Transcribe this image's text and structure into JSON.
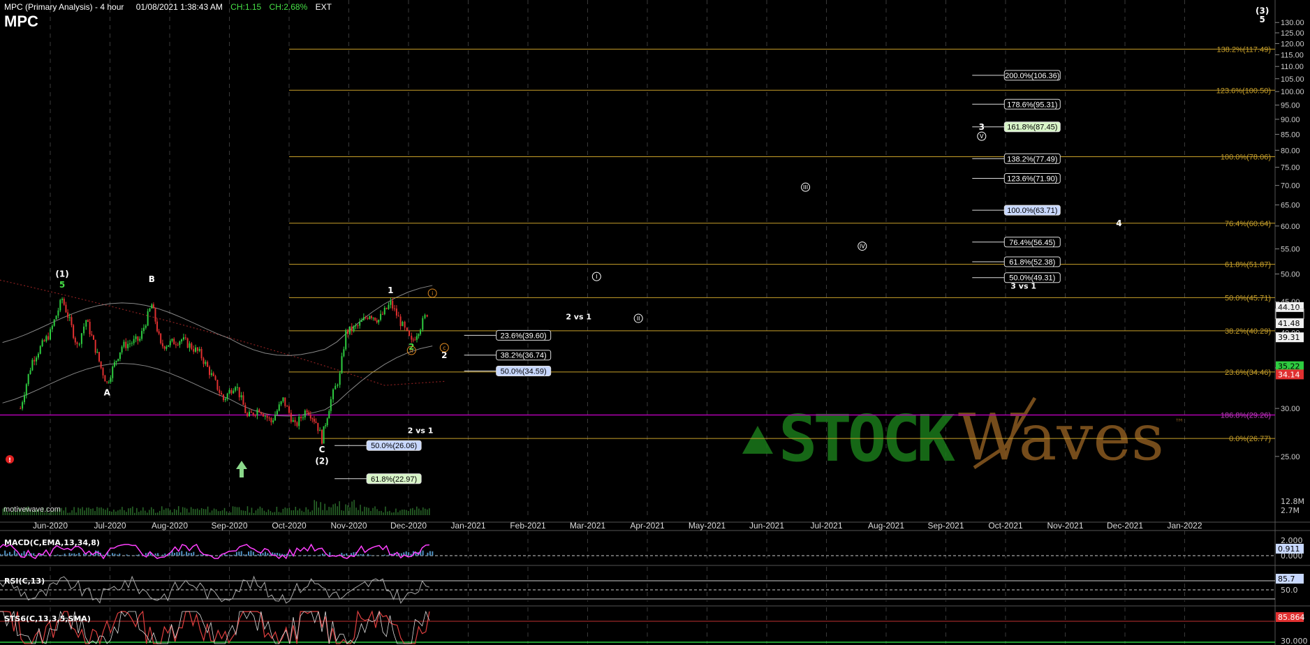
{
  "header": {
    "title": "MPC (Primary Analysis) - 4 hour",
    "datetime": "01/08/2021 1:38:43 AM",
    "change": "CH:1.15",
    "change_pct": "CH:2.68%",
    "session": "EXT",
    "symbol": "MPC"
  },
  "watermark": "motivewave.com",
  "brand": {
    "left": "STOCK",
    "right": "Waves",
    "mark": "™"
  },
  "colors": {
    "background": "#000000",
    "fib_line": "#c8a02a",
    "fib_label": "#c8a02a",
    "grid": "#3a3a3a",
    "candle_up": "#2ecc40",
    "candle_down": "#e03030",
    "ma_red": "#8a2020",
    "band": "#888888",
    "purple_line": "#b000b0",
    "macd_line": "#ff40ff",
    "macd_hist": "#5090c0",
    "stoch_line": "#e04040",
    "brand_green": "#1a7a1a",
    "brand_orange": "#8a5a20"
  },
  "chart_data": {
    "type": "candlestick",
    "price_axis": {
      "min": 20,
      "max": 135,
      "ticks": [
        25.0,
        30.0,
        35.0,
        40.0,
        45.0,
        50.0,
        55.0,
        60.0,
        65.0,
        70.0,
        75.0,
        80.0,
        85.0,
        90.0,
        95.0,
        100.0,
        105.0,
        110.0,
        115.0,
        120.0,
        125.0,
        130.0
      ],
      "scale": "log"
    },
    "time_axis": {
      "labels": [
        "Jun-2020",
        "Jul-2020",
        "Aug-2020",
        "Sep-2020",
        "Oct-2020",
        "Nov-2020",
        "Dec-2020",
        "Jan-2021",
        "Feb-2021",
        "Mar-2021",
        "Apr-2021",
        "May-2021",
        "Jun-2021",
        "Jul-2021",
        "Aug-2021",
        "Sep-2021",
        "Oct-2021",
        "Nov-2021",
        "Dec-2021",
        "Jan-2022"
      ],
      "month_index": [
        0,
        1,
        2,
        3,
        4,
        5,
        6,
        7,
        8,
        9,
        10,
        11,
        12,
        13,
        14,
        15,
        16,
        17,
        18,
        19
      ]
    },
    "price_path": [
      {
        "m": -0.5,
        "p": 30
      },
      {
        "m": -0.3,
        "p": 36
      },
      {
        "m": 0.0,
        "p": 40
      },
      {
        "m": 0.2,
        "p": 45.5
      },
      {
        "m": 0.45,
        "p": 38
      },
      {
        "m": 0.6,
        "p": 42
      },
      {
        "m": 0.85,
        "p": 35
      },
      {
        "m": 0.95,
        "p": 33
      },
      {
        "m": 1.2,
        "p": 38
      },
      {
        "m": 1.5,
        "p": 39
      },
      {
        "m": 1.7,
        "p": 44.5
      },
      {
        "m": 1.85,
        "p": 38
      },
      {
        "m": 2.2,
        "p": 39
      },
      {
        "m": 2.5,
        "p": 37
      },
      {
        "m": 2.7,
        "p": 34
      },
      {
        "m": 2.9,
        "p": 31
      },
      {
        "m": 3.1,
        "p": 33
      },
      {
        "m": 3.3,
        "p": 29
      },
      {
        "m": 3.5,
        "p": 30
      },
      {
        "m": 3.7,
        "p": 28.5
      },
      {
        "m": 3.9,
        "p": 31
      },
      {
        "m": 4.1,
        "p": 28
      },
      {
        "m": 4.3,
        "p": 30
      },
      {
        "m": 4.45,
        "p": 28.5
      },
      {
        "m": 4.55,
        "p": 26.7
      },
      {
        "m": 4.7,
        "p": 31
      },
      {
        "m": 4.85,
        "p": 34
      },
      {
        "m": 4.95,
        "p": 40
      },
      {
        "m": 5.15,
        "p": 41
      },
      {
        "m": 5.35,
        "p": 43
      },
      {
        "m": 5.5,
        "p": 42
      },
      {
        "m": 5.7,
        "p": 44.7
      },
      {
        "m": 5.9,
        "p": 41
      },
      {
        "m": 6.05,
        "p": 38.5
      },
      {
        "m": 6.2,
        "p": 41
      },
      {
        "m": 6.35,
        "p": 43.8
      }
    ],
    "last_price": 43.72,
    "price_tags": [
      {
        "label": "44.10",
        "value": 44.1,
        "style": "white"
      },
      {
        "label": "41.48",
        "value": 41.48,
        "style": "white"
      },
      {
        "label": "39.31",
        "value": 39.31,
        "style": "white"
      },
      {
        "label": "35.22",
        "value": 35.22,
        "style": "green"
      },
      {
        "label": "34.14",
        "value": 34.14,
        "style": "red"
      }
    ],
    "fib_levels_right": [
      {
        "label": "138.2%(117.49)",
        "value": 117.49
      },
      {
        "label": "123.6%(100.50)",
        "value": 100.5
      },
      {
        "label": "100.0%(78.06)",
        "value": 78.06
      },
      {
        "label": "76.4%(60.64)",
        "value": 60.64
      },
      {
        "label": "61.8%(51.87)",
        "value": 51.87
      },
      {
        "label": "50.0%(45.71)",
        "value": 45.71
      },
      {
        "label": "38.2%(40.29)",
        "value": 40.29
      },
      {
        "label": "23.6%(34.46)",
        "value": 34.46
      },
      {
        "label": "186.8%(29.26)",
        "value": 29.26,
        "color": "purple"
      },
      {
        "label": "0.0%(26.77)",
        "value": 26.77
      }
    ],
    "extension_targets": [
      {
        "label": "200.0%(106.36)",
        "value": 106.36,
        "style": "dark"
      },
      {
        "label": "178.6%(95.31)",
        "value": 95.31,
        "style": "dark"
      },
      {
        "label": "161.8%(87.45)",
        "value": 87.45,
        "style": "green"
      },
      {
        "label": "138.2%(77.49)",
        "value": 77.49,
        "style": "dark"
      },
      {
        "label": "123.6%(71.90)",
        "value": 71.9,
        "style": "dark"
      },
      {
        "label": "100.0%(63.71)",
        "value": 63.71,
        "style": "blue"
      },
      {
        "label": "76.4%(56.45)",
        "value": 56.45,
        "style": "dark"
      },
      {
        "label": "61.8%(52.38)",
        "value": 52.38,
        "style": "dark"
      },
      {
        "label": "50.0%(49.31)",
        "value": 49.31,
        "style": "dark"
      }
    ],
    "extension_group_label": "3 vs 1",
    "retrace_targets": [
      {
        "label": "23.6%(39.60)",
        "value": 39.6,
        "style": "dark"
      },
      {
        "label": "38.2%(36.74)",
        "value": 36.74,
        "style": "dark"
      },
      {
        "label": "50.0%(34.59)",
        "value": 34.59,
        "style": "blue"
      }
    ],
    "retrace_group_label": "2 vs 1",
    "lower_targets": [
      {
        "label": "50.0%(26.06)",
        "value": 26.06,
        "style": "blue"
      },
      {
        "label": "61.8%(22.97)",
        "value": 22.97,
        "style": "green"
      }
    ],
    "lower_group_label": "2 vs 1",
    "wave_labels": [
      {
        "text": "(1)",
        "m": 0.2,
        "p": 49.5,
        "color": "#ffffff"
      },
      {
        "text": "5",
        "m": 0.2,
        "p": 47.5,
        "color": "#46e046"
      },
      {
        "text": "B",
        "m": 1.7,
        "p": 48.5,
        "color": "#ffffff"
      },
      {
        "text": "A",
        "m": 0.95,
        "p": 31.5,
        "color": "#ffffff"
      },
      {
        "text": "C",
        "m": 4.55,
        "p": 25.4,
        "color": "#ffffff"
      },
      {
        "text": "(2)",
        "m": 4.55,
        "p": 24.3,
        "color": "#ffffff"
      },
      {
        "text": "1",
        "m": 5.7,
        "p": 46.5,
        "color": "#ffffff"
      },
      {
        "text": "2",
        "m": 6.05,
        "p": 37.5,
        "color": "#46e046"
      },
      {
        "text": "2",
        "m": 6.6,
        "p": 36.3,
        "color": "#ffffff"
      },
      {
        "text": "3",
        "m": 15.6,
        "p": 86.5,
        "color": "#ffffff"
      },
      {
        "text": "4",
        "m": 17.9,
        "p": 60.0,
        "color": "#ffffff"
      },
      {
        "text": "(3)",
        "m": 20.3,
        "p": 134.5,
        "color": "#ffffff"
      },
      {
        "text": "5",
        "m": 20.3,
        "p": 130.0,
        "color": "#ffffff"
      }
    ],
    "circled_labels": [
      {
        "text": "i",
        "m": 6.4,
        "p": 46.0,
        "color": "#e08a20"
      },
      {
        "text": "ii",
        "m": 6.05,
        "p": 37.0,
        "color": "#e08a20"
      },
      {
        "text": "c",
        "m": 6.6,
        "p": 37.4,
        "color": "#e08a20"
      },
      {
        "text": "I",
        "m": 9.15,
        "p": 49.0,
        "color": "#ffffff"
      },
      {
        "text": "II",
        "m": 9.85,
        "p": 41.8,
        "color": "#ffffff"
      },
      {
        "text": "III",
        "m": 12.65,
        "p": 68.8,
        "color": "#ffffff"
      },
      {
        "text": "IV",
        "m": 13.6,
        "p": 55.0,
        "color": "#ffffff"
      },
      {
        "text": "V",
        "m": 15.6,
        "p": 83.5,
        "color": "#ffffff"
      }
    ],
    "indicators": {
      "macd": {
        "label": "MACD(C,EMA,13,34,8)",
        "ticks": [
          "2.000",
          "0.000"
        ],
        "value_tag": "0.911"
      },
      "rsi": {
        "label": "RSI(C,13)",
        "ticks": [
          "50.0"
        ],
        "value_tag": "85.7"
      },
      "stoch": {
        "label": "STS6(C,13,3,5,SMA)",
        "ticks": [
          "30.000"
        ],
        "value_tag": "85.864"
      }
    },
    "volume_ticks": [
      "12.8M",
      "2.7M"
    ]
  }
}
